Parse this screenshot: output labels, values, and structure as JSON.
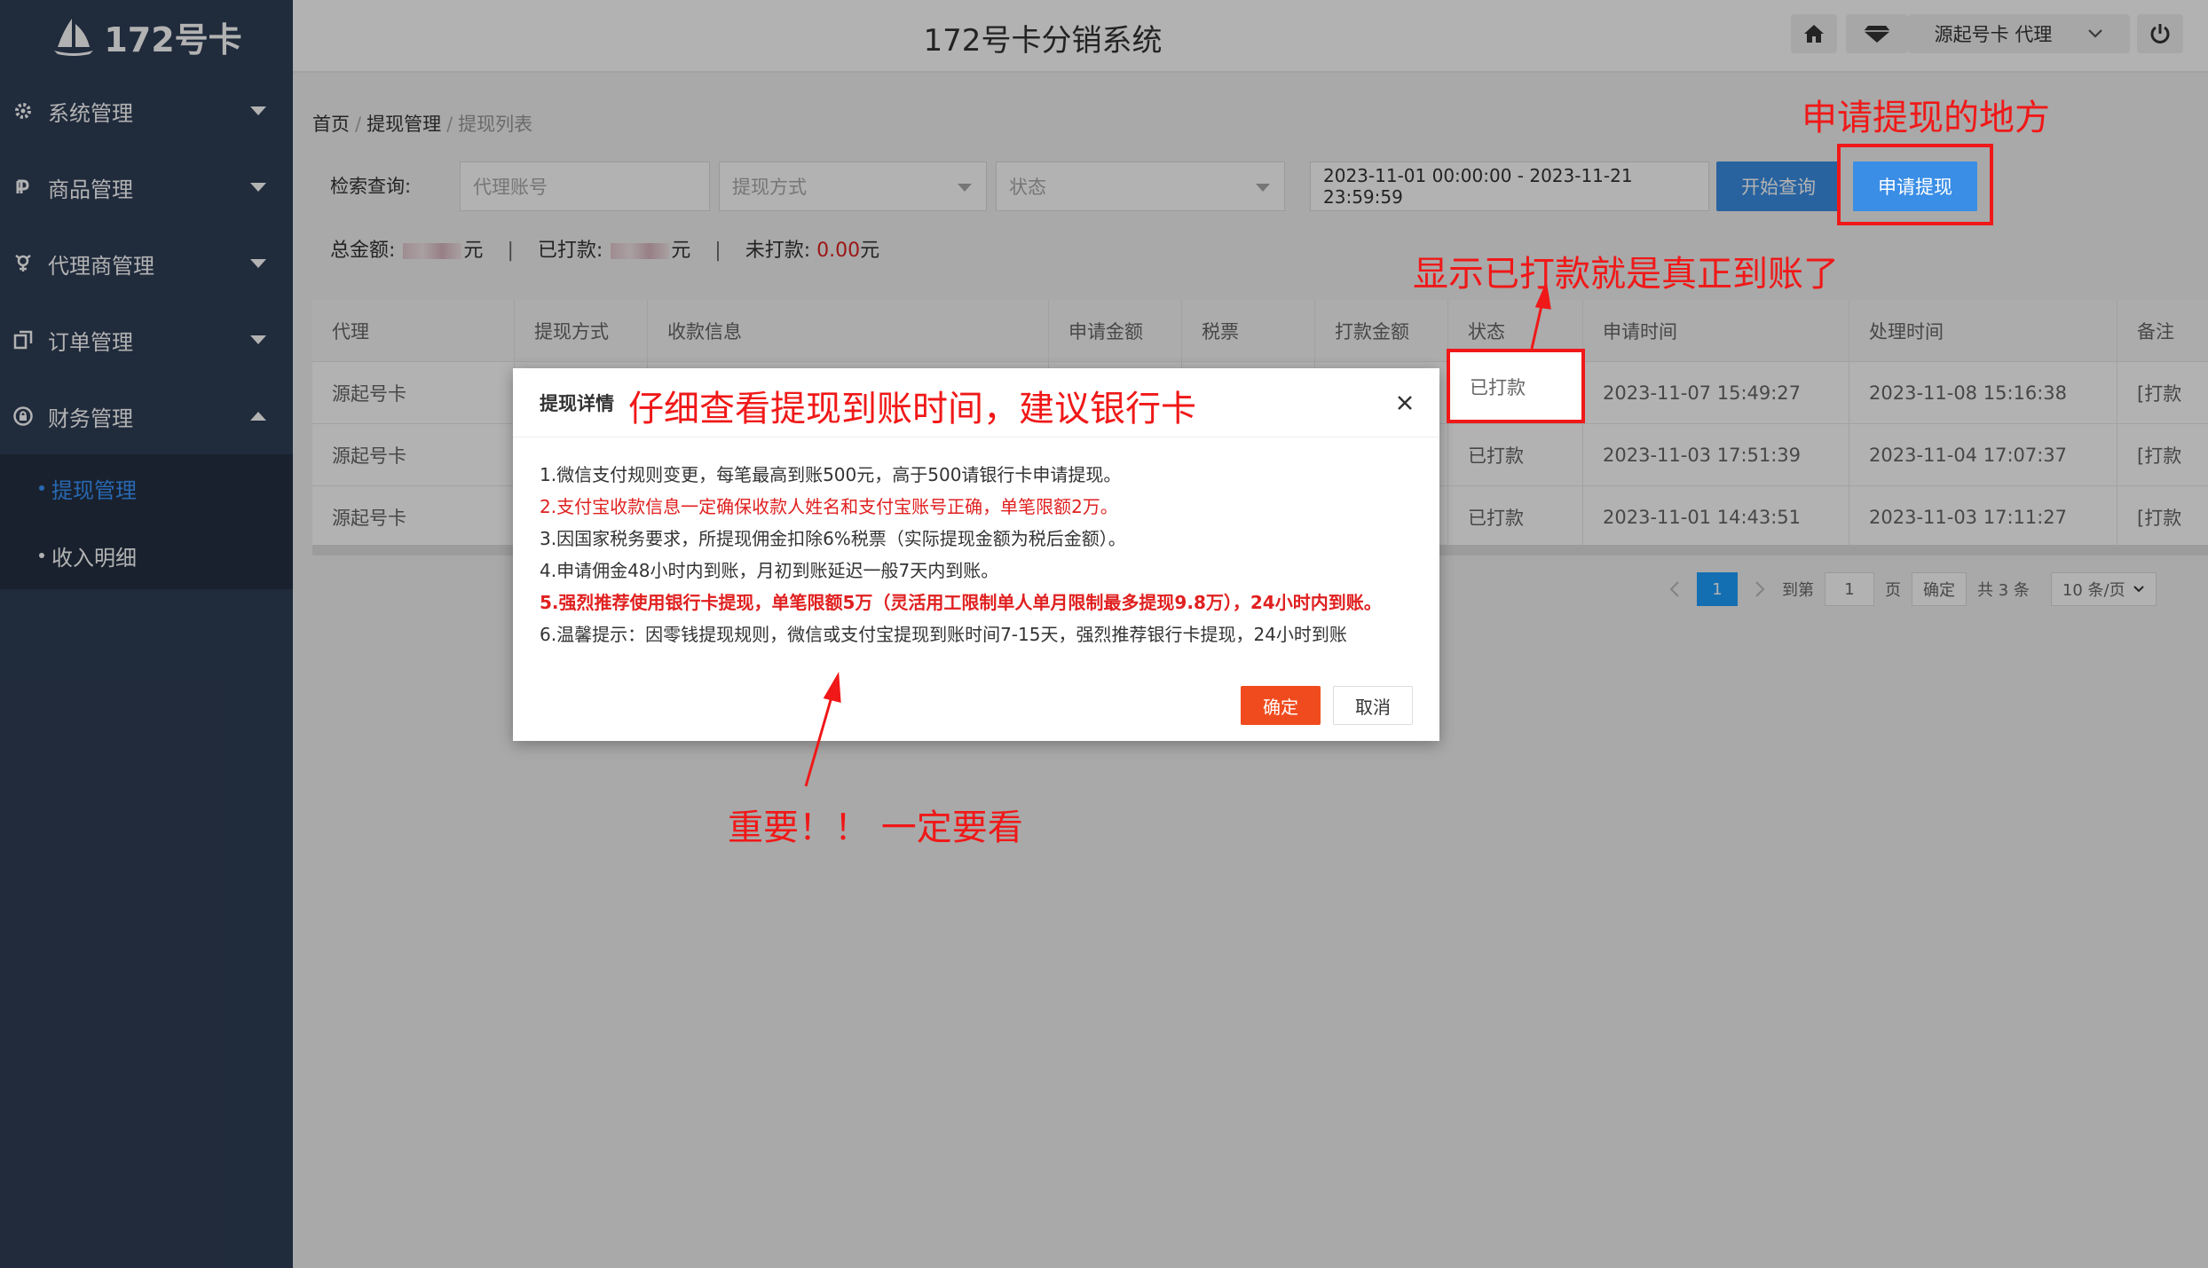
{
  "app": {
    "logo_text": "172号卡",
    "title": "172号卡分销系统"
  },
  "header": {
    "user_label": "源起号卡 代理"
  },
  "sidebar": {
    "items": [
      {
        "label": "系统管理"
      },
      {
        "label": "商品管理"
      },
      {
        "label": "代理商管理"
      },
      {
        "label": "订单管理"
      },
      {
        "label": "财务管理"
      }
    ],
    "sub_items": [
      {
        "label": "提现管理"
      },
      {
        "label": "收入明细"
      }
    ]
  },
  "breadcrumb": {
    "home": "首页",
    "section": "提现管理",
    "current": "提现列表"
  },
  "search": {
    "label": "检索查询:",
    "account_placeholder": "代理账号",
    "method_placeholder": "提现方式",
    "status_placeholder": "状态",
    "date_range": "2023-11-01 00:00:00 - 2023-11-21 23:59:59",
    "search_button": "开始查询",
    "apply_button": "申请提现"
  },
  "totals": {
    "total_label": "总金额:",
    "paid_label": "已打款:",
    "unpaid_label": "未打款:",
    "unpaid_value": "0.00",
    "unit": "元",
    "pipe": "|"
  },
  "table": {
    "headers": [
      "代理",
      "提现方式",
      "收款信息",
      "申请金额",
      "税票",
      "打款金额",
      "状态",
      "申请时间",
      "处理时间",
      "备注"
    ],
    "rows": [
      {
        "agent": "源起号卡",
        "status": "已打款",
        "apply_time": "2023-11-07 15:49:27",
        "process_time": "2023-11-08 15:16:38",
        "note": "[打款"
      },
      {
        "agent": "源起号卡",
        "status": "已打款",
        "apply_time": "2023-11-03 17:51:39",
        "process_time": "2023-11-04 17:07:37",
        "note": "[打款"
      },
      {
        "agent": "源起号卡",
        "status": "已打款",
        "apply_time": "2023-11-01 14:43:51",
        "process_time": "2023-11-03 17:11:27",
        "note": "[打款"
      }
    ]
  },
  "pager": {
    "current_page": "1",
    "goto_label": "到第",
    "goto_value": "1",
    "page_unit": "页",
    "confirm": "确定",
    "total": "共 3 条",
    "page_size": "10 条/页"
  },
  "dialog": {
    "title": "提现详情",
    "lines": [
      "1.微信支付规则变更，每笔最高到账500元，高于500请银行卡申请提现。",
      "2.支付宝收款信息一定确保收款人姓名和支付宝账号正确，单笔限额2万。",
      "3.因国家税务要求，所提现佣金扣除6%税票（实际提现金额为税后金额）。",
      "4.申请佣金48小时内到账，月初到账延迟一般7天内到账。",
      "5.强烈推荐使用银行卡提现，单笔限额5万（灵活用工限制单人单月限制最多提现9.8万），24小时内到账。",
      "6.温馨提示：因零钱提现规则，微信或支付宝提现到账时间7-15天，强烈推荐银行卡提现，24小时到账"
    ],
    "ok": "确定",
    "cancel": "取消"
  },
  "annotations": {
    "apply_hint": "申请提现的地方",
    "status_hint": "显示已打款就是真正到账了",
    "dialog_hint": "仔细查看提现到账时间，建议银行卡",
    "important_hint": "重要！！ 一定要看"
  },
  "colors": {
    "sidebar_bg": "#2f3e56",
    "accent_blue": "#3a8ee6",
    "annotation_red": "#f01818",
    "ok_button": "#f04b1e"
  }
}
